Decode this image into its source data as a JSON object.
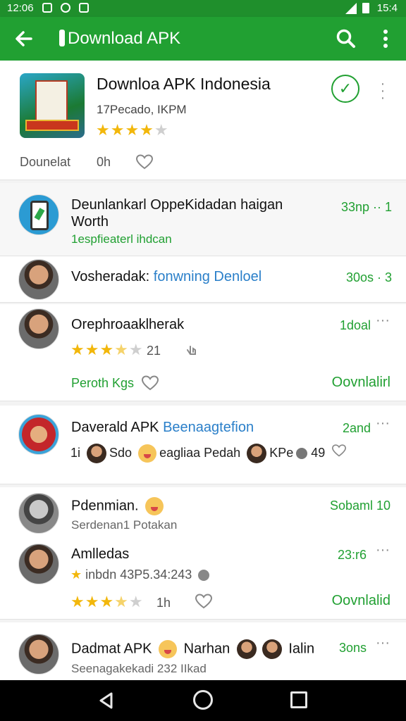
{
  "status": {
    "time_left": "12:06",
    "time_right": "15:4"
  },
  "app_bar": {
    "title": "Download APK",
    "back_icon": "arrow-left-icon",
    "search_icon": "search-icon",
    "more_icon": "more-vert-icon"
  },
  "header": {
    "title": "Downloa APK Indonesia",
    "subtitle": "17Pecado, IKPM",
    "rating": 4,
    "meta_left": "Dounelat",
    "meta_right": "0h"
  },
  "rows": [
    {
      "title": "Deunlankarl OppeKidadan haigan",
      "title2": "Worth",
      "sub": "1espfieaterl ihdcan",
      "right": "33np ·· 1"
    },
    {
      "title": "Vosheradak:",
      "title_blue": "fonwning Denloel",
      "right": "30os · 3"
    },
    {
      "title": "Orephroaaklherak",
      "right": "1doal",
      "rating": 3.5,
      "count": "21",
      "action": "Peroth Kgs",
      "download": "Oovnlalirl"
    },
    {
      "title": "Daverald APK",
      "title_blue": "Beenaagtefion",
      "right": "2and",
      "line": [
        "1i",
        "Sdo",
        "eagliaa Pedah",
        "KPe",
        "49"
      ]
    },
    {
      "title": "Pdenmian.",
      "sub": "Serdenan1 Potakan",
      "right": "Sobaml 10"
    },
    {
      "title": "Amlledas",
      "sub": "inbdn 43P5.34:243",
      "right": "23:r6",
      "rating": 3.5,
      "time": "1h",
      "download": "Oovnlalid"
    },
    {
      "title": "Dadmat APK",
      "title_extra": "Narhan",
      "title_extra2": "Ialin",
      "sub": "Seenagakekadi 232 IIkad",
      "right": "3ons"
    }
  ],
  "nav": {
    "back": "nav-back-icon",
    "home": "nav-home-icon",
    "recent": "nav-recent-icon"
  }
}
